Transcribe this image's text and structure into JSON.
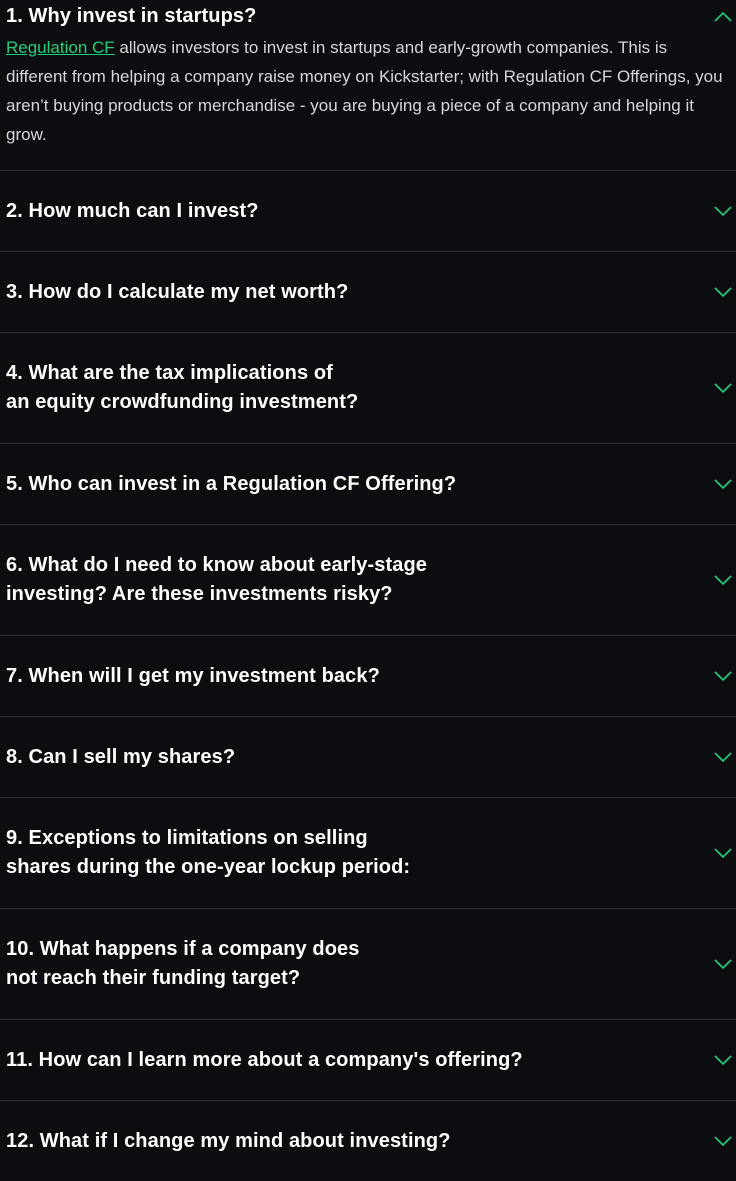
{
  "accent_color": "#21d07a",
  "background_color": "#0c0d10",
  "faq": {
    "items": [
      {
        "question": "1. Why invest in startups?",
        "expanded": true,
        "answer": {
          "link_text": "Regulation CF",
          "text": " allows investors to invest in startups and early-growth companies. This is different from helping a company raise money on Kickstarter; with Regulation CF Offerings, you aren’t buying products or merchandise - you are buying a piece of a company and helping it grow."
        },
        "chevron_icon": "chevron-up-icon"
      },
      {
        "question": "2. How much can I invest?",
        "expanded": false,
        "chevron_icon": "chevron-down-icon"
      },
      {
        "question": "3. How do I calculate my net worth?",
        "expanded": false,
        "chevron_icon": "chevron-down-icon"
      },
      {
        "question": "4. What are the tax implications of an equity crowdfunding investment?",
        "line1": "4. What are the tax implications of",
        "line2": "an equity crowdfunding investment?",
        "expanded": false,
        "chevron_icon": "chevron-down-icon"
      },
      {
        "question": "5. Who can invest in a Regulation CF Offering?",
        "expanded": false,
        "chevron_icon": "chevron-down-icon"
      },
      {
        "question": "6. What do I need to know about early-stage investing? Are these investments risky?",
        "line1": "6. What do I need to know about early-stage",
        "line2": "investing? Are these investments risky?",
        "expanded": false,
        "chevron_icon": "chevron-down-icon"
      },
      {
        "question": "7. When will I get my investment back?",
        "expanded": false,
        "chevron_icon": "chevron-down-icon"
      },
      {
        "question": "8. Can I sell my shares?",
        "expanded": false,
        "chevron_icon": "chevron-down-icon"
      },
      {
        "question": "9. Exceptions to limitations on selling shares during the one-year lockup period:",
        "line1": "9. Exceptions to limitations on selling",
        "line2": "shares during the one-year lockup period:",
        "expanded": false,
        "chevron_icon": "chevron-down-icon"
      },
      {
        "question": "10. What happens if a company does not reach their funding target?",
        "line1": "10. What happens if a company does",
        "line2": "not reach their funding target?",
        "expanded": false,
        "chevron_icon": "chevron-down-icon"
      },
      {
        "question": "11. How can I learn more about a company's offering?",
        "expanded": false,
        "chevron_icon": "chevron-down-icon"
      },
      {
        "question": "12. What if I change my mind about investing?",
        "expanded": false,
        "chevron_icon": "chevron-down-icon"
      }
    ]
  }
}
